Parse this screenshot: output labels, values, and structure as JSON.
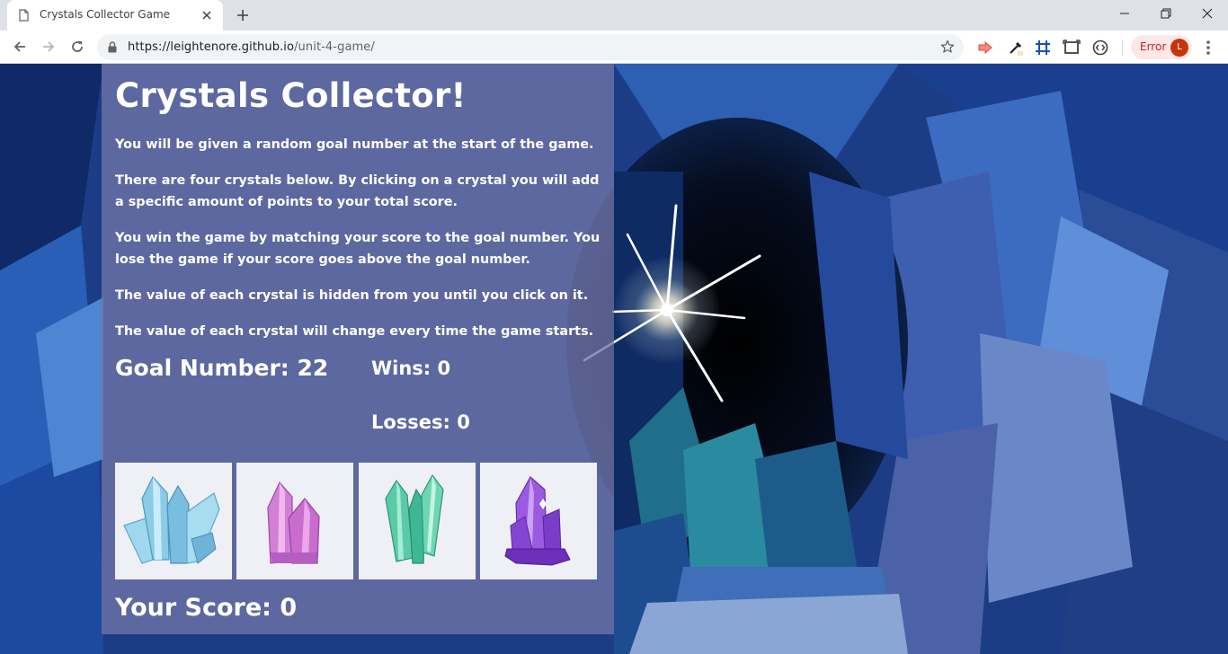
{
  "browser": {
    "tab_title": "Crystals Collector Game",
    "url_host": "https://leightenore.github.io",
    "url_path": "/unit-4-game/",
    "error_label": "Error",
    "avatar_letter": "L"
  },
  "game": {
    "title": "Crystals Collector!",
    "instructions": [
      "You will be given a random goal number at the start of the game.",
      "There are four crystals below. By clicking on a crystal you will add a specific amount of points to your total score.",
      "You win the game by matching your score to the goal number. You lose the game if your score goes above the goal number.",
      "The value of each crystal is hidden from you until you click on it.",
      "The value of each crystal will change every time the game starts."
    ],
    "goal_text": "Goal Number: 22",
    "wins_text": "Wins: 0",
    "losses_text": "Losses: 0",
    "score_text": "Your Score: 0",
    "crystals": [
      {
        "icon": "blue-crystal-icon",
        "color": "#8fd0ea"
      },
      {
        "icon": "pink-crystal-icon",
        "color": "#d77ad6"
      },
      {
        "icon": "green-crystal-icon",
        "color": "#4cc6a1"
      },
      {
        "icon": "purple-crystal-icon",
        "color": "#8a4ad0"
      }
    ]
  }
}
